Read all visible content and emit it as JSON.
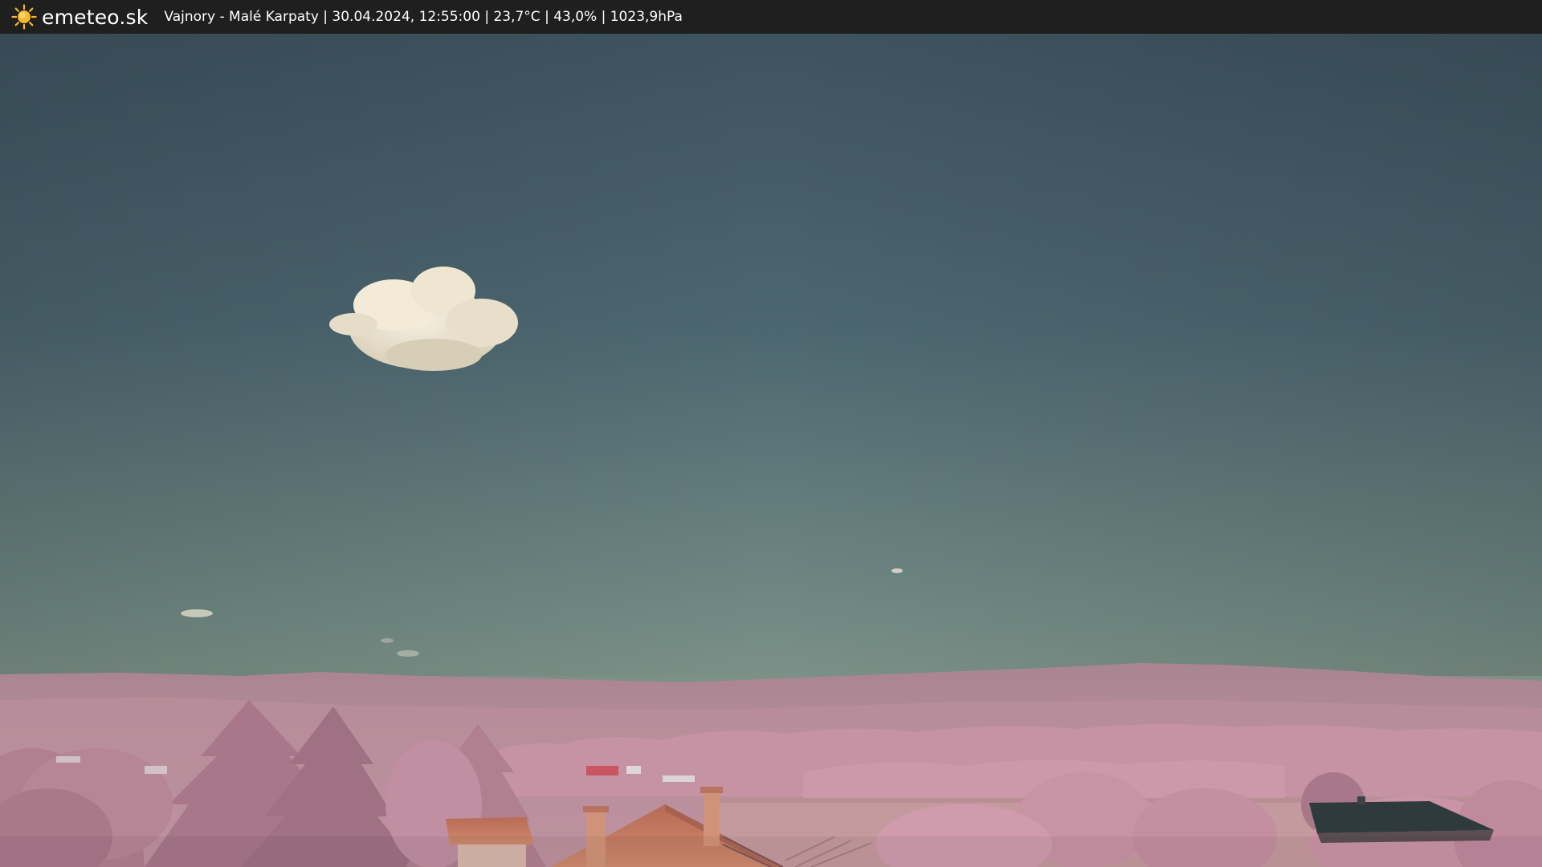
{
  "header": {
    "brand": "emeteo.sk",
    "brand_icon": "sun-icon",
    "caption": "Vajnory - Malé Karpaty | 30.04.2024, 12:55:00 | 23,7°C | 43,0% | 1023,9hPa"
  },
  "colors": {
    "topbar_bg": "#1f1f1f",
    "sun": "#f5b82e",
    "sky_top": "#3e5360",
    "sky_bottom": "#8a9a8c",
    "hills": "#b38a97",
    "foliage": "#c792a6",
    "roof": "#c8745f"
  }
}
